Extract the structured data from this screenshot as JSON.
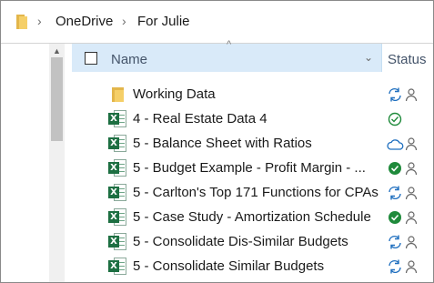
{
  "breadcrumb": {
    "items": [
      "OneDrive",
      "For Julie"
    ]
  },
  "columns": {
    "name": "Name",
    "status": "Status"
  },
  "files": [
    {
      "name": "Working Data",
      "type": "folder",
      "status": [
        "sync",
        "shared"
      ]
    },
    {
      "name": "4 - Real Estate Data 4",
      "type": "excel",
      "status": [
        "available"
      ]
    },
    {
      "name": "5 - Balance Sheet with Ratios",
      "type": "excel",
      "status": [
        "cloud",
        "shared"
      ]
    },
    {
      "name": "5 - Budget Example - Profit Margin - ...",
      "type": "excel",
      "status": [
        "always-available",
        "shared"
      ]
    },
    {
      "name": "5 - Carlton's Top 171 Functions for CPAs",
      "type": "excel",
      "status": [
        "sync",
        "shared"
      ]
    },
    {
      "name": "5 - Case Study - Amortization Schedule",
      "type": "excel",
      "status": [
        "always-available",
        "shared"
      ]
    },
    {
      "name": "5 - Consolidate Dis-Similar Budgets",
      "type": "excel",
      "status": [
        "sync",
        "shared"
      ]
    },
    {
      "name": "5 - Consolidate Similar Budgets",
      "type": "excel",
      "status": [
        "sync",
        "shared"
      ]
    }
  ],
  "colors": {
    "header_selected_bg": "#d9eaf9",
    "excel_green": "#1d6f42",
    "sync_blue": "#1f6fbf",
    "available_green": "#1f8a3b"
  }
}
